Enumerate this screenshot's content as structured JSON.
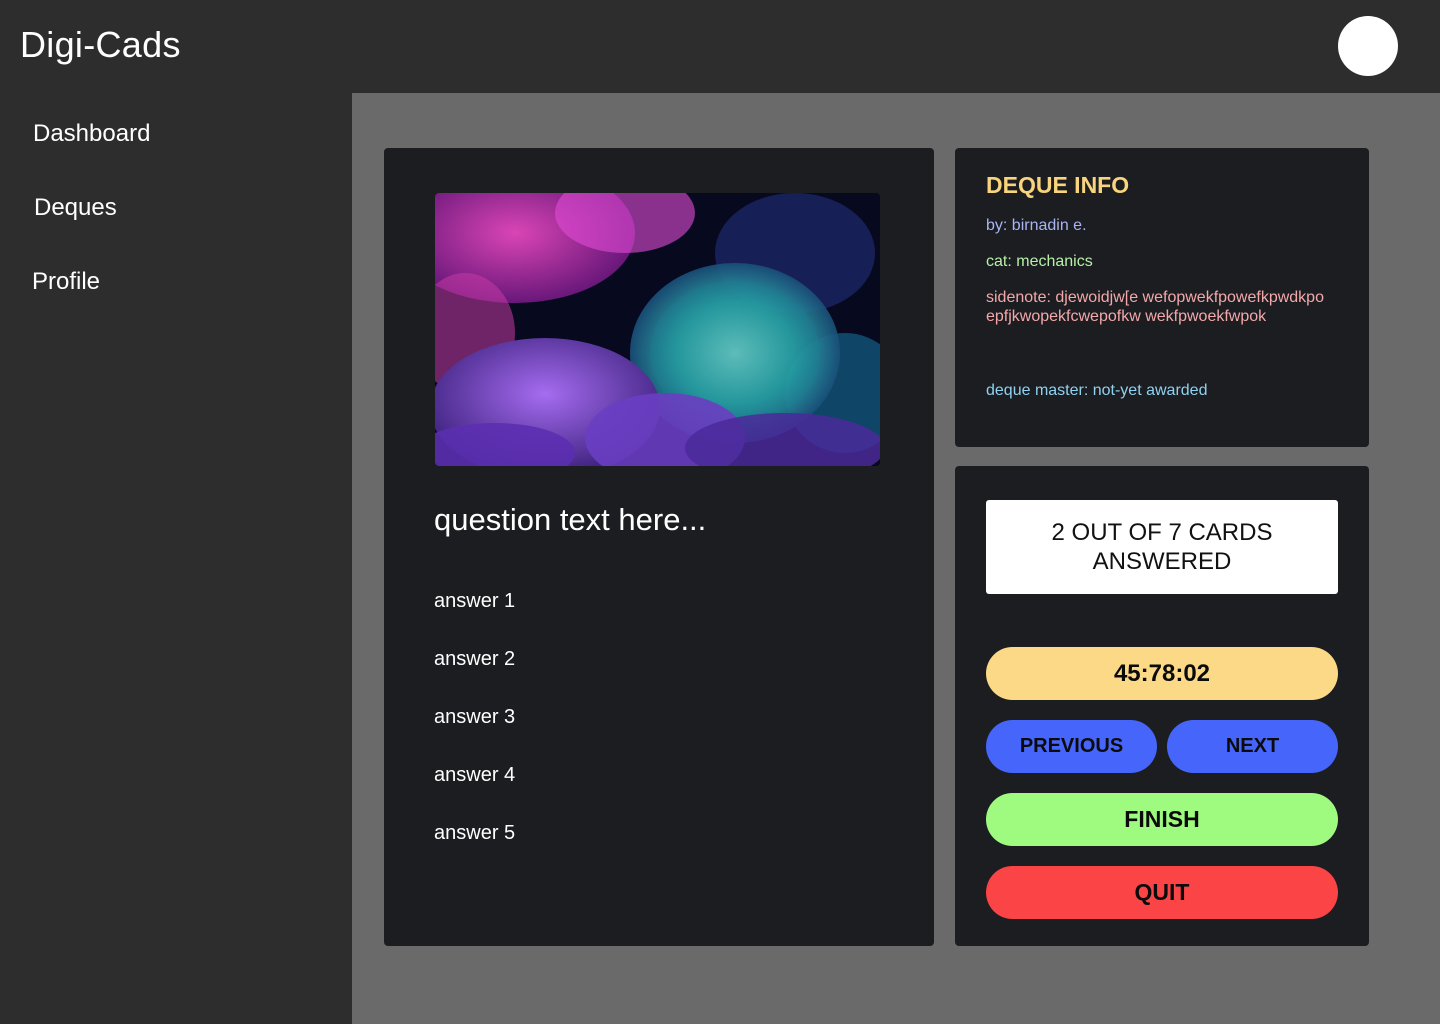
{
  "app": {
    "title": "Digi-Cads"
  },
  "sidebar": {
    "items": [
      {
        "label": "Dashboard"
      },
      {
        "label": "Deques"
      },
      {
        "label": "Profile"
      }
    ]
  },
  "card": {
    "image_icon": "coral-reef-photo",
    "question": "question text here...",
    "answers": [
      "answer 1",
      "answer 2",
      "answer 3",
      "answer 4",
      "answer 5"
    ]
  },
  "deque_info": {
    "title": "DEQUE INFO",
    "by": "by: birnadin e.",
    "cat": "cat: mechanics",
    "sidenote": "sidenote: djewoidjw[e wefopwekfpowefkpwdkpo epfjkwopekfcwepofkw wekfpwoekfwpok",
    "master": "deque master: not-yet awarded"
  },
  "controls": {
    "progress": "2 OUT OF 7 CARDS ANSWERED",
    "timer": "45:78:02",
    "previous_label": "PREVIOUS",
    "next_label": "NEXT",
    "finish_label": "FINISH",
    "quit_label": "QUIT"
  },
  "colors": {
    "sidebar_bg": "#2d2d2e",
    "main_bg": "#6a6a6a",
    "panel_bg": "#1c1d21",
    "info_title": "#f8d47c",
    "timer": "#fbd986",
    "nav_buttons": "#4666fb",
    "finish": "#9efb80",
    "quit": "#fb4446"
  }
}
